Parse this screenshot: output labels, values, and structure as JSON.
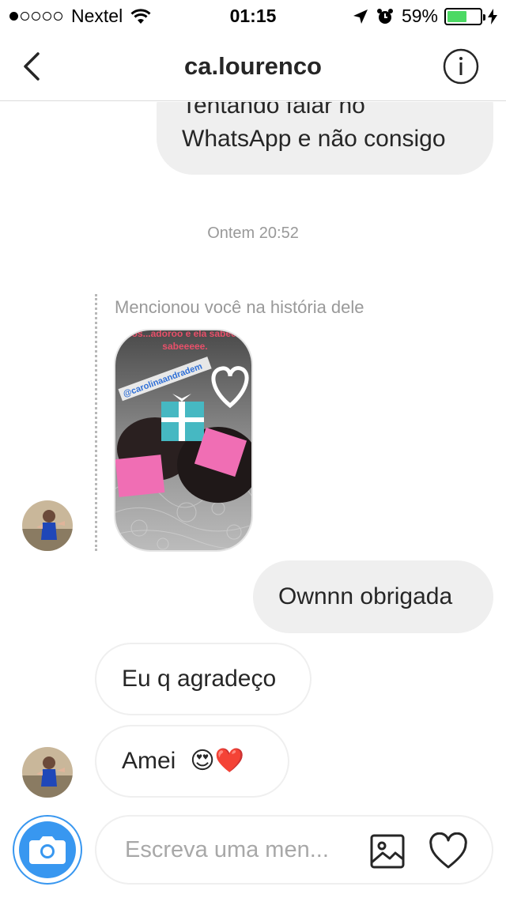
{
  "status_bar": {
    "carrier": "Nextel",
    "time": "01:15",
    "battery": "59%",
    "battery_level": 0.59,
    "signal_bars_filled": 1,
    "signal_bars_total": 5
  },
  "header": {
    "title": "ca.lourenco",
    "back_icon": "chevron-left-icon",
    "info_icon": "info-circle-icon"
  },
  "messages": {
    "m1": {
      "line1": "Tentando falar no",
      "line2": "WhatsApp e não consigo"
    },
    "timestamp": "Ontem 20:52",
    "mention_label": "Mencionou você na história dele",
    "m2": "Ownnn obrigada",
    "m3": "Eu q agradeço",
    "m4": "Amei",
    "m4_emoji": "😍❤️"
  },
  "story": {
    "caption_top": "...mos...adoroo e ela sabeeeee.",
    "mention_tag": "@carolinaandradem"
  },
  "composer": {
    "placeholder": "Escreva uma men...",
    "camera_icon": "camera-icon",
    "gallery_icon": "image-icon",
    "like_icon": "heart-icon"
  },
  "colors": {
    "accent": "#3897f0",
    "bubble_me": "#efefef",
    "muted_text": "#999999",
    "battery_green": "#4cd964"
  }
}
